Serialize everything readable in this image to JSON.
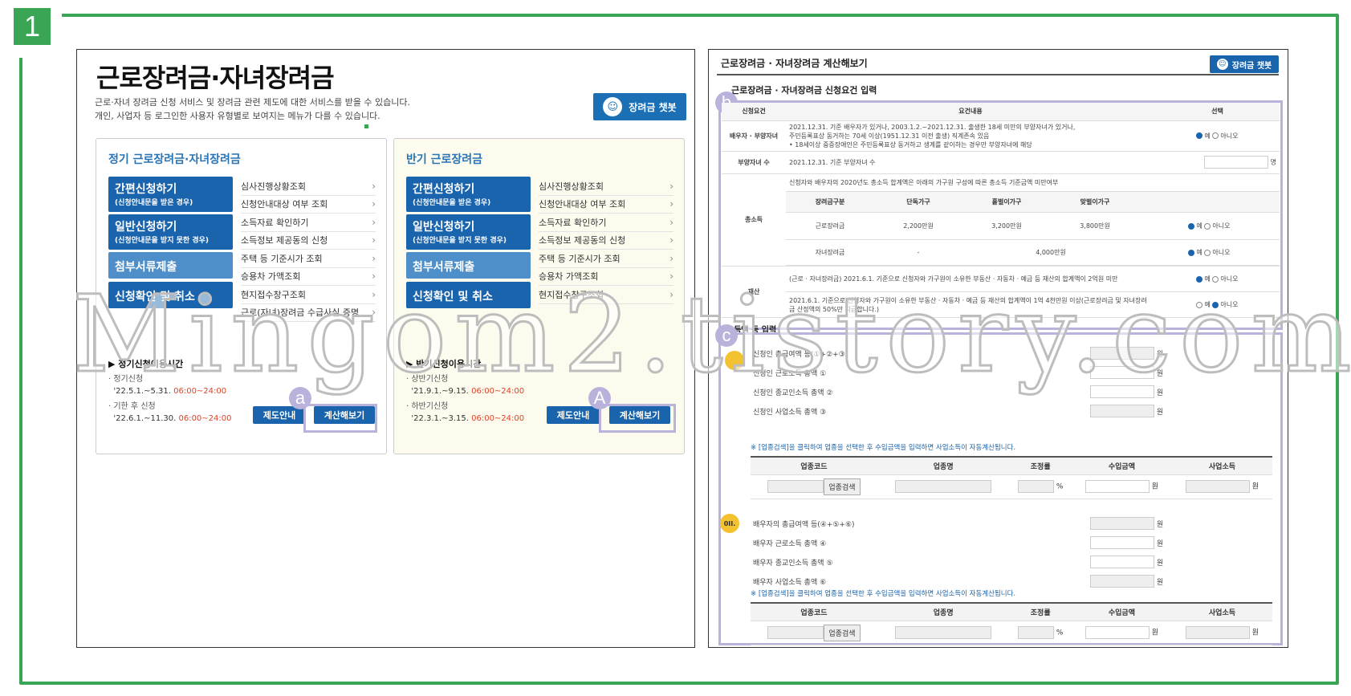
{
  "step_number": "1",
  "left": {
    "title": "근로장려금·자녀장려금",
    "desc_line1": "근로·자녀 장려금 신청 서비스 및 장려금 관련 제도에 대한 서비스를 받을 수 있습니다.",
    "desc_line2": "개인, 사업자 등 로그인한 사용자 유형별로 보여지는 메뉴가 다를 수 있습니다.",
    "chatbot_label": "장려금 챗봇",
    "box1": {
      "title": "정기 근로장려금·자녀장려금",
      "buttons": [
        {
          "main": "간편신청하기",
          "sub": "(신청안내문을 받은 경우)"
        },
        {
          "main": "일반신청하기",
          "sub": "(신청안내문을 받지 못한 경우)"
        },
        {
          "main": "첨부서류제출",
          "sub": ""
        },
        {
          "main": "신청확인 및 취소",
          "sub": ""
        }
      ],
      "links": [
        "심사진행상황조회",
        "신청안내대상 여부 조회",
        "소득자료 확인하기",
        "소득정보 제공동의 신청",
        "주택 등 기준시가 조회",
        "승용차 가액조회",
        "현지접수창구조회",
        "근로(자녀)장려금 수급사실 증명"
      ],
      "time_title": "▶ 정기신청이용시간",
      "t1_label": "· 정기신청",
      "t1_date": "'22.5.1.~5.31.",
      "t1_time": "06:00~24:00",
      "t2_label": "· 기한 후 신청",
      "t2_date": "'22.6.1.~11.30.",
      "t2_time": "06:00~24:00",
      "btn_guide": "제도안내",
      "btn_calc": "계산해보기",
      "badge": "a"
    },
    "box2": {
      "title": "반기 근로장려금",
      "buttons": [
        {
          "main": "간편신청하기",
          "sub": "(신청안내문을 받은 경우)"
        },
        {
          "main": "일반신청하기",
          "sub": "(신청안내문을 받지 못한 경우)"
        },
        {
          "main": "첨부서류제출",
          "sub": ""
        },
        {
          "main": "신청확인 및 취소",
          "sub": ""
        }
      ],
      "links": [
        "심사진행상황조회",
        "신청안내대상 여부 조회",
        "소득자료 확인하기",
        "소득정보 제공동의 신청",
        "주택 등 기준시가 조회",
        "승용차 가액조회",
        "현지접수창구조회"
      ],
      "time_title": "▶ 반기신청이용시간",
      "t1_label": "· 상반기신청",
      "t1_date": "'21.9.1.~9.15.",
      "t1_time": "06:00~24:00",
      "t2_label": "· 하반기신청",
      "t2_date": "'22.3.1.~3.15.",
      "t2_time": "06:00~24:00",
      "btn_guide": "제도안내",
      "btn_calc": "계산해보기",
      "badge": "A"
    }
  },
  "right": {
    "title": "근로장려금 · 자녀장려금 계산해보기",
    "chatbot_label": "장려금 챗봇",
    "sub_title": "근로장려금 · 자녀장려금 신청요건 입력",
    "badge_b": "b",
    "badge_c": "c",
    "req_headers": [
      "신청요건",
      "요건내용",
      "선택"
    ],
    "row1_label": "배우자 · 부양자녀",
    "row1_text1": "2021.12.31. 기준 배우자가 있거나, 2003.1.2.~2021.12.31. 출생한 18세 미만의 부양자녀가 있거나,",
    "row1_text2": "주민등록표상 동거하는 70세 이상(1951.12.31 이전 출생) 직계존속 있음",
    "row1_text3": "• 18세이상 중증장애인은 주민등록표상 동거하고 생계를 같이하는 경우만 부양자녀에 해당",
    "row2_label": "부양자녀 수",
    "row2_text": "2021.12.31. 기준 부양자녀 수",
    "row2_unit": "명",
    "row3_label": "총소득",
    "row3_text": "신청자와 배우자의 2020년도 총소득 합계액은 아래의 가구원 구성에 따른 총소득 기준금액 미만여부",
    "inc_headers": [
      "장려금구분",
      "단독가구",
      "홑벌이가구",
      "맞벌이가구"
    ],
    "inc_r1": [
      "근로장려금",
      "2,200만원",
      "3,200만원",
      "3,800만원"
    ],
    "inc_r2": [
      "자녀장려금",
      "-",
      "4,000만원"
    ],
    "row4_label": "재산",
    "row4_text1": "(근로 · 자녀장려금) 2021.6.1. 기준으로 신청자와 가구원이 소유한 부동산 · 자동차 · 예금 등 재산의 합계액이 2억원 미만",
    "row4_text2": "2021.6.1. 기준으로 신청자와 가구원이 소유한 부동산 · 자동차 · 예금 등 재산의 합계액이 1억 4천만원 이상(근로장려금 및 자녀장려금 산정액의 50%만 지급합니다.)",
    "yes": "예",
    "no": "아니오",
    "sec2_title": "소득액 등 입력",
    "app_fields": [
      "신청인 총급여액 등(①+②+③)",
      "신청인 근로소득 총액 ①",
      "신청인 종교인소득 총액 ②",
      "신청인 사업소득 총액 ③"
    ],
    "spouse_fields": [
      "배우자의 총급여액 등(④+⑤+⑥)",
      "배우자 근로소득 총액 ④",
      "배우자 종교인소득 총액 ⑤",
      "배우자 사업소득 총액 ⑥"
    ],
    "won": "원",
    "percent": "%",
    "note": "※ [업종검색]을 클릭하여 업종을 선택한 후 수입금액을 입력하면 사업소득이 자동계산됩니다.",
    "biz_headers": [
      "업종코드",
      "업종명",
      "조정률",
      "수입금액",
      "사업소득"
    ],
    "search_btn": "업종검색",
    "spouse_icon": "0II."
  },
  "watermark": "Mingom2.tistory.com"
}
